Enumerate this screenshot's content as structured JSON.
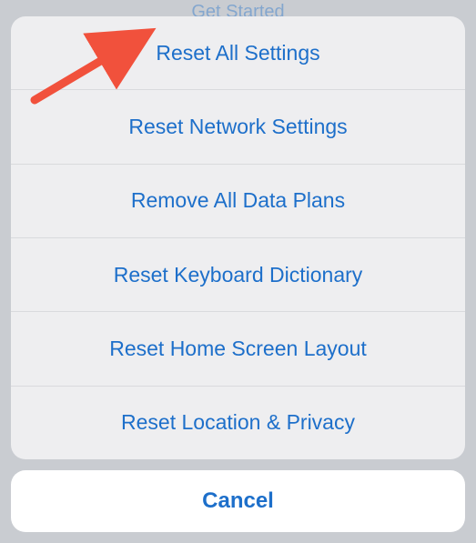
{
  "background_hint": "Get Started",
  "sheet": {
    "options": [
      {
        "label": "Reset All Settings"
      },
      {
        "label": "Reset Network Settings"
      },
      {
        "label": "Remove All Data Plans"
      },
      {
        "label": "Reset Keyboard Dictionary"
      },
      {
        "label": "Reset Home Screen Layout"
      },
      {
        "label": "Reset Location & Privacy"
      }
    ],
    "cancel_label": "Cancel"
  },
  "annotation": {
    "type": "arrow",
    "color": "#f1513c"
  }
}
